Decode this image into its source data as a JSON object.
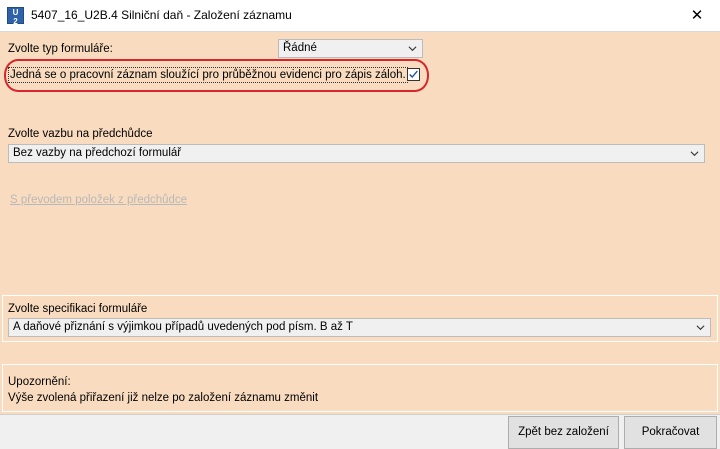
{
  "window": {
    "app_icon_text_top": "U",
    "app_icon_text_bottom": "2",
    "title": "5407_16_U2B.4 Silniční daň - Založení záznamu",
    "close_glyph": "✕"
  },
  "form_type": {
    "label": "Zvolte typ formuláře:",
    "value": "Řádné"
  },
  "working_record": {
    "label": "Jedná se o pracovní záznam sloužící pro průběžnou evidenci pro zápis záloh.",
    "checked": true,
    "highlight_color": "#d7262d"
  },
  "predecessor": {
    "label": "Zvolte vazbu na předchůdce",
    "value": "Bez vazby na předchozí formulář",
    "transfer_link": "S převodem položek z předchůdce"
  },
  "specification": {
    "label": "Zvolte specifikaci formuláře",
    "value": "A daňové přiznání s výjimkou případů uvedených pod písm. B až T"
  },
  "warning": {
    "title": "Upozornění:",
    "text": "Výše zvolená přiřazení již nelze po založení záznamu změnit"
  },
  "buttons": {
    "back_without_create": "Zpět bez založení",
    "continue": "Pokračovat"
  },
  "colors": {
    "client_background": "#f9dcc0",
    "combo_background": "#f0f0f0"
  },
  "icons": [
    "app-icon",
    "close-icon",
    "chevron-down-icon",
    "checkmark-icon"
  ]
}
